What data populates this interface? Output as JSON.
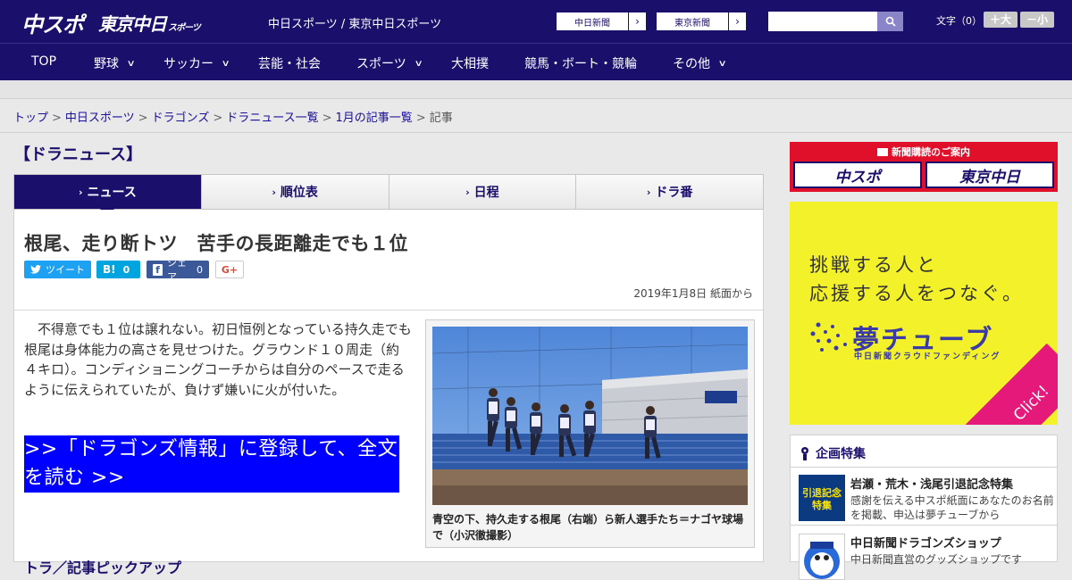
{
  "header": {
    "logo_chunichi": "中スポ",
    "logo_tokyo": "東京中日",
    "logo_tokyo_small": "スポーツ",
    "site_names": "中日スポーツ / 東京中日スポーツ",
    "link_chunichi": "中日新聞",
    "link_tokyo": "東京新聞",
    "fontsize_label": "文字（0）",
    "font_bigger": "＋大",
    "font_smaller": "－小"
  },
  "nav": {
    "items": [
      {
        "label": "TOP",
        "dropdown": false
      },
      {
        "label": "野球",
        "dropdown": true
      },
      {
        "label": "サッカー",
        "dropdown": true
      },
      {
        "label": "芸能・社会",
        "dropdown": false
      },
      {
        "label": "スポーツ",
        "dropdown": true
      },
      {
        "label": "大相撲",
        "dropdown": false
      },
      {
        "label": "競馬・ボート・競輪",
        "dropdown": false
      },
      {
        "label": "その他",
        "dropdown": true
      }
    ]
  },
  "breadcrumb": {
    "items": [
      "トップ",
      "中日スポーツ",
      "ドラゴンズ",
      "ドラニュース一覧",
      "1月の記事一覧"
    ],
    "current": "記事",
    "separator": ">"
  },
  "section_title": "【ドラニュース】",
  "tabs": [
    {
      "label": "ニュース",
      "active": true
    },
    {
      "label": "順位表",
      "active": false
    },
    {
      "label": "日程",
      "active": false
    },
    {
      "label": "ドラ番",
      "active": false
    }
  ],
  "article": {
    "headline": "根尾、走り断トツ　苦手の長距離走でも１位",
    "share": {
      "tweet": "ツイート",
      "hatena_count": "0",
      "fb_label": "シェア",
      "fb_count": "0",
      "gplus": "G+"
    },
    "date": "2019年1月8日 紙面から",
    "body": "不得意でも１位は譲れない。初日恒例となっている持久走でも根尾は身体能力の高さを見せつけた。グラウンド１０周走（約４キロ）。コンディショニングコーチからは自分のペースで走るように伝えられていたが、負けず嫌いに火が付いた。",
    "cta": ">>「ドラゴンズ情報」に登録して、全文を読む >>",
    "photo_caption": "青空の下、持久走する根尾（右端）ら新人選手たち＝ナゴヤ球場で（小沢徹撮影）",
    "next_heading": "トラ／記事ピックアップ"
  },
  "sidebar": {
    "subscribe_title": "新聞購読のご案内",
    "subscribe_logo1": "中スポ",
    "subscribe_logo2": "東京中日",
    "yume_line1": "挑戦する人と",
    "yume_line2": "応援する人をつなぐ。",
    "yume_logo": "夢チューブ",
    "yume_sub": "中日新聞クラウドファンディング",
    "yume_click": "Click!",
    "feature_title": "企画特集",
    "features": [
      {
        "title": "岩瀬・荒木・浅尾引退記念特集",
        "desc": "感謝を伝える中スポ紙面にあなたのお名前を掲載、申込は夢チューブから",
        "thumb_text": "引退記念特集"
      },
      {
        "title": "中日新聞ドラゴンズショップ",
        "desc": "中日新聞直営のグッズショップです",
        "thumb_text": ""
      }
    ]
  },
  "colors": {
    "brand_navy": "#1a0f6b",
    "cta_blue": "#0000ff",
    "twitter": "#1da1f2",
    "hatena": "#00a4de",
    "facebook": "#3b5998",
    "yume_yellow": "#f3f12a",
    "sub_red": "#e0102a"
  }
}
